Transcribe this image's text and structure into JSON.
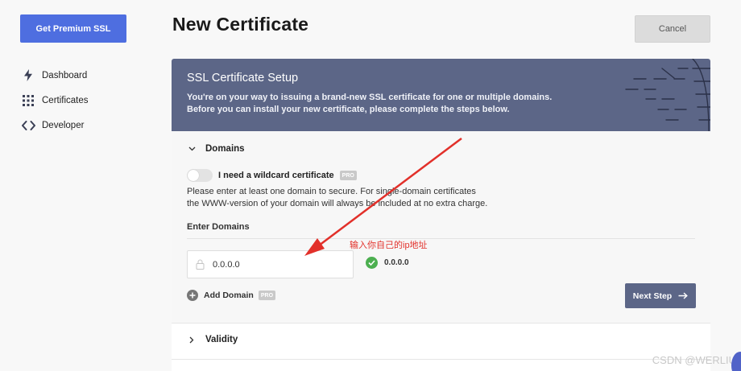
{
  "sidebar": {
    "premium_button": "Get Premium SSL",
    "items": [
      {
        "label": "Dashboard",
        "icon": "bolt-icon"
      },
      {
        "label": "Certificates",
        "icon": "grid-icon"
      },
      {
        "label": "Developer",
        "icon": "code-icon"
      }
    ]
  },
  "header": {
    "title": "New Certificate",
    "cancel_label": "Cancel"
  },
  "card": {
    "title": "SSL Certificate Setup",
    "intro_line1": "You're on your way to issuing a brand-new SSL certificate for one or multiple domains.",
    "intro_line2": "Before you can install your new certificate, please complete the steps below.",
    "domains_section": {
      "title": "Domains",
      "wildcard_label": "I need a wildcard certificate",
      "pro_badge": "PRO",
      "helper_line1": "Please enter at least one domain to secure. For single-domain certificates",
      "helper_line2": "the WWW-version of your domain will always be included at no extra charge.",
      "enter_label": "Enter Domains",
      "domain_value": "0.0.0.0",
      "validated_domain": "0.0.0.0",
      "add_domain_label": "Add Domain",
      "next_step_label": "Next Step"
    },
    "validity_section": {
      "title": "Validity"
    }
  },
  "annotation": {
    "text": "输入你自己的ip地址",
    "color": "#e2302a"
  },
  "watermark": "CSDN @WERLIU",
  "colors": {
    "accent": "#4e6ee0",
    "header_bg": "#5c6687",
    "success": "#4caf50"
  }
}
